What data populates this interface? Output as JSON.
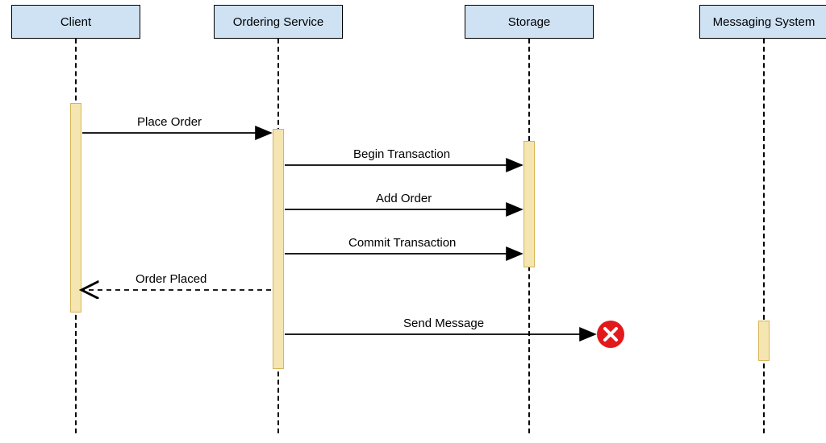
{
  "participants": {
    "client": "Client",
    "ordering": "Ordering Service",
    "storage": "Storage",
    "messaging": "Messaging System"
  },
  "messages": {
    "place_order": "Place Order",
    "begin_tx": "Begin Transaction",
    "add_order": "Add Order",
    "commit_tx": "Commit Transaction",
    "order_placed": "Order Placed",
    "send_message": "Send Message"
  },
  "colors": {
    "participant_fill": "#CFE2F3",
    "activation_fill": "#F4E5B1",
    "activation_border": "#D7B55A",
    "error": "#E31A1C"
  }
}
